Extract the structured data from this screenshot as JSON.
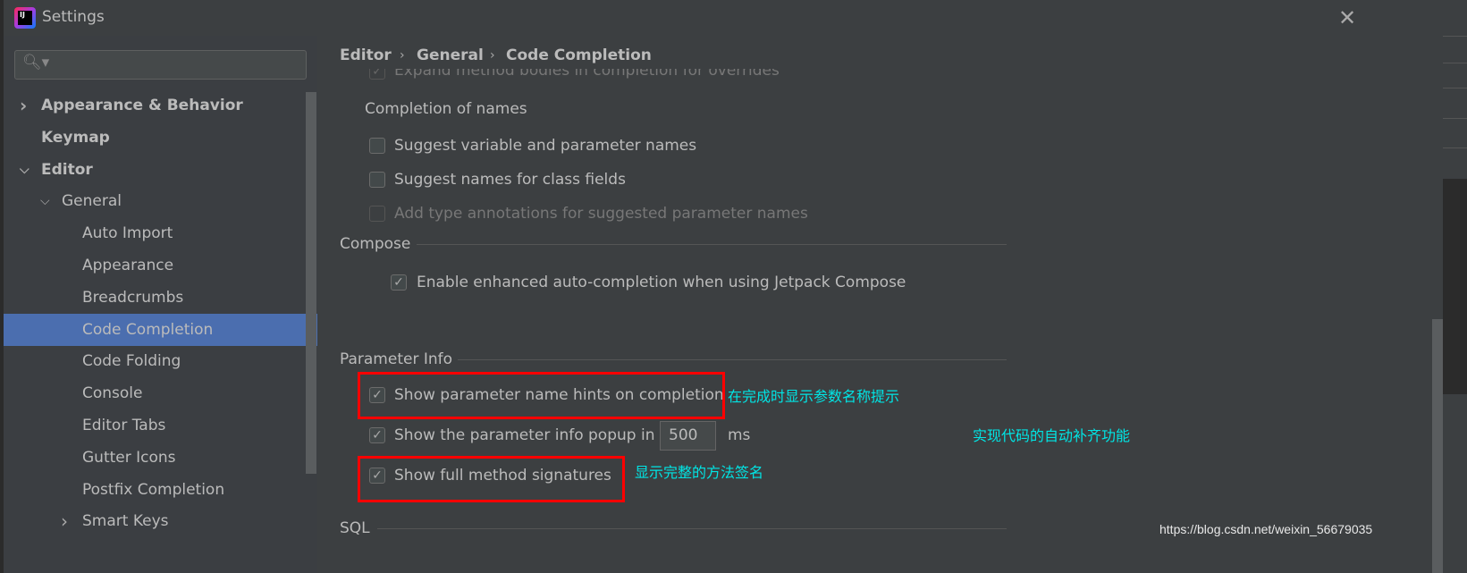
{
  "window": {
    "title": "Settings",
    "close_icon": "close-icon",
    "logo": "intellij-idea-logo"
  },
  "search": {
    "placeholder": "",
    "icon": "search-icon"
  },
  "sidebar": {
    "items": [
      {
        "label": "Appearance & Behavior",
        "level": 0,
        "bold": true,
        "expander": "collapsed"
      },
      {
        "label": "Keymap",
        "level": 0,
        "bold": true
      },
      {
        "label": "Editor",
        "level": 0,
        "bold": true,
        "expander": "expanded"
      },
      {
        "label": "General",
        "level": 1,
        "expander": "expanded"
      },
      {
        "label": "Auto Import",
        "level": 2
      },
      {
        "label": "Appearance",
        "level": 2
      },
      {
        "label": "Breadcrumbs",
        "level": 2
      },
      {
        "label": "Code Completion",
        "level": 2,
        "selected": true
      },
      {
        "label": "Code Folding",
        "level": 2
      },
      {
        "label": "Console",
        "level": 2
      },
      {
        "label": "Editor Tabs",
        "level": 2
      },
      {
        "label": "Gutter Icons",
        "level": 2
      },
      {
        "label": "Postfix Completion",
        "level": 2
      },
      {
        "label": "Smart Keys",
        "level": 2,
        "expander": "collapsed"
      }
    ]
  },
  "breadcrumb": [
    "Editor",
    "General",
    "Code Completion"
  ],
  "content": {
    "partial_option": {
      "label": "Expand method bodies in completion for overrides",
      "checked": true
    },
    "completion_of_names": {
      "title": "Completion of names",
      "options": [
        {
          "label": "Suggest variable and parameter names",
          "checked": false,
          "enabled": true
        },
        {
          "label": "Suggest names for class fields",
          "checked": false,
          "enabled": true
        },
        {
          "label": "Add type annotations for suggested parameter names",
          "checked": false,
          "enabled": false
        }
      ]
    },
    "compose": {
      "title": "Compose",
      "options": [
        {
          "label": "Enable enhanced auto-completion when using Jetpack Compose",
          "checked": true
        }
      ]
    },
    "parameter_info": {
      "title": "Parameter Info",
      "hints": {
        "label": "Show parameter name hints on completion",
        "checked": true
      },
      "popup": {
        "label": "Show the parameter info popup in",
        "checked": true,
        "value": "500",
        "unit": "ms"
      },
      "full_sig": {
        "label": "Show full method signatures",
        "checked": true
      }
    },
    "sql": {
      "title": "SQL"
    }
  },
  "annotations": {
    "hints": "在完成时显示参数名称提示",
    "popup": "实现代码的自动补齐功能",
    "full_sig": "显示完整的方法签名",
    "color": "#00e5e5",
    "highlight_color": "#ff0000"
  },
  "watermark": "https://blog.csdn.net/weixin_56679035",
  "colors": {
    "selection": "#4b6eaf",
    "background": "#3c3f41"
  }
}
